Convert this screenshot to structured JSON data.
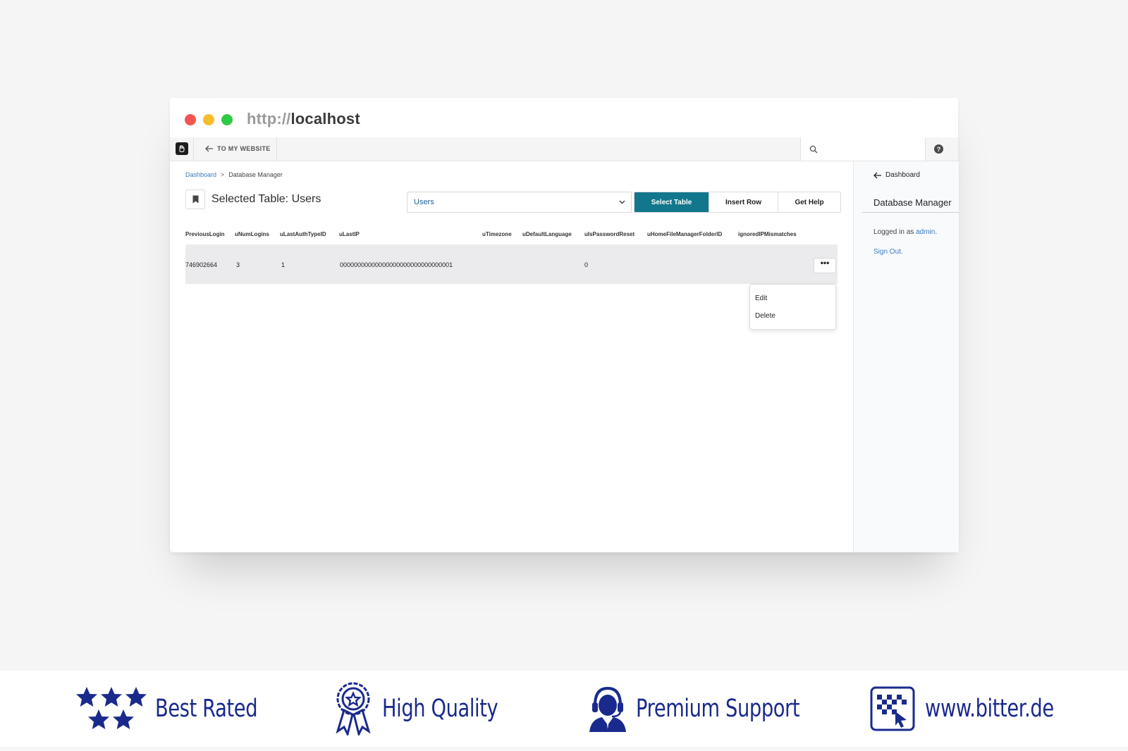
{
  "browser": {
    "url_protocol": "http://",
    "url_host": "localhost"
  },
  "toolbar": {
    "back_label": "TO MY WEBSITE"
  },
  "breadcrumb": {
    "root": "Dashboard",
    "separator": ">",
    "current": "Database Manager"
  },
  "page": {
    "title": "Selected Table: Users"
  },
  "table_select": {
    "selected": "Users"
  },
  "buttons": {
    "select_table": "Select Table",
    "insert_row": "Insert Row",
    "get_help": "Get Help"
  },
  "table": {
    "columns": [
      "PreviousLogin",
      "uNumLogins",
      "uLastAuthTypeID",
      "uLastIP",
      "uTimezone",
      "uDefaultLanguage",
      "uIsPasswordReset",
      "uHomeFileManagerFolderID",
      "ignoredIPMismatches"
    ],
    "row": {
      "PreviousLogin": "746902664",
      "uNumLogins": "3",
      "uLastAuthTypeID": "1",
      "uLastIP": "00000000000000000000000000000001",
      "uIsPasswordReset": "0",
      "actions_label": "•••"
    }
  },
  "row_menu": {
    "edit": "Edit",
    "delete": "Delete"
  },
  "sidebar": {
    "back_label": "Dashboard",
    "title": "Database Manager",
    "logged_in_prefix": "Logged in as",
    "username": "admin",
    "logged_in_suffix": ".",
    "sign_out": "Sign Out."
  },
  "badges": {
    "best_rated": "Best Rated",
    "high_quality": "High Quality",
    "premium_support": "Premium Support",
    "website": "www.bitter.de"
  },
  "colors": {
    "primary_button": "#12778c",
    "link": "#3a7bbf",
    "badge_text": "#1a2a8c",
    "traffic_red": "#f25451",
    "traffic_yellow": "#f5bd2c",
    "traffic_green": "#2fca44"
  }
}
